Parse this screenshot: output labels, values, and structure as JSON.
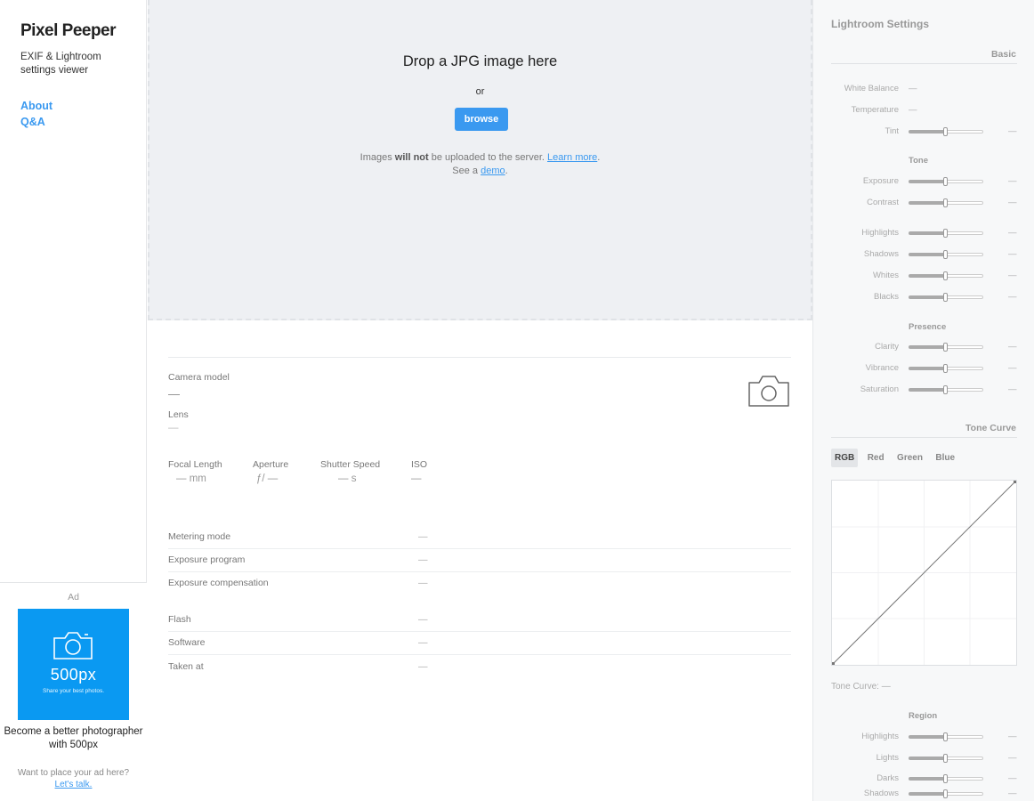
{
  "sidebar": {
    "brand": "Pixel Peeper",
    "tagline": "EXIF & Lightroom settings viewer",
    "nav": [
      {
        "label": "About"
      },
      {
        "label": "Q&A"
      }
    ],
    "ad": {
      "label": "Ad",
      "brand": "500px",
      "sub": "Share your best photos.",
      "title": "Become a better photographer with 500px",
      "foot": "Want to place your ad here?",
      "foot_link": "Let's talk."
    }
  },
  "dropzone": {
    "title": "Drop a JPG image here",
    "or": "or",
    "browse_label": "browse",
    "note_pre": "Images ",
    "note_bold": "will not",
    "note_post": " be uploaded to the server. ",
    "learn_more": "Learn more",
    "period": ".",
    "see_a": "See a ",
    "demo": "demo",
    "period2": "."
  },
  "exif": {
    "camera_model_label": "Camera model",
    "camera_model_value": "—",
    "lens_label": "Lens",
    "lens_value": "—",
    "focal_length_label": "Focal Length",
    "focal_length_value": "— mm",
    "aperture_label": "Aperture",
    "aperture_value": "ƒ/ —",
    "shutter_label": "Shutter Speed",
    "shutter_value": "— s",
    "iso_label": "ISO",
    "iso_value": "—",
    "rows_a": [
      {
        "label": "Metering mode",
        "value": "—"
      },
      {
        "label": "Exposure program",
        "value": "—"
      },
      {
        "label": "Exposure compensation",
        "value": "—"
      }
    ],
    "rows_b": [
      {
        "label": "Flash",
        "value": "—"
      },
      {
        "label": "Software",
        "value": "—"
      },
      {
        "label": "Taken at",
        "value": "—"
      }
    ]
  },
  "lightroom": {
    "title": "Lightroom Settings",
    "basic_label": "Basic",
    "white_balance_label": "White Balance",
    "white_balance_value": "—",
    "temperature_label": "Temperature",
    "temperature_value": "—",
    "tint_label": "Tint",
    "tint_value": "—",
    "tone_label": "Tone",
    "tone": [
      {
        "label": "Exposure",
        "value": "—"
      },
      {
        "label": "Contrast",
        "value": "—"
      },
      {
        "label": "Highlights",
        "value": "—"
      },
      {
        "label": "Shadows",
        "value": "—"
      },
      {
        "label": "Whites",
        "value": "—"
      },
      {
        "label": "Blacks",
        "value": "—"
      }
    ],
    "presence_label": "Presence",
    "presence": [
      {
        "label": "Clarity",
        "value": "—"
      },
      {
        "label": "Vibrance",
        "value": "—"
      },
      {
        "label": "Saturation",
        "value": "—"
      }
    ],
    "tone_curve_label": "Tone Curve",
    "tabs": [
      {
        "label": "RGB"
      },
      {
        "label": "Red"
      },
      {
        "label": "Green"
      },
      {
        "label": "Blue"
      }
    ],
    "tone_curve_value": "Tone Curve: —",
    "region_label": "Region",
    "region": [
      {
        "label": "Highlights",
        "value": "—"
      },
      {
        "label": "Lights",
        "value": "—"
      },
      {
        "label": "Darks",
        "value": "—"
      },
      {
        "label": "Shadows",
        "value": "—"
      }
    ]
  }
}
